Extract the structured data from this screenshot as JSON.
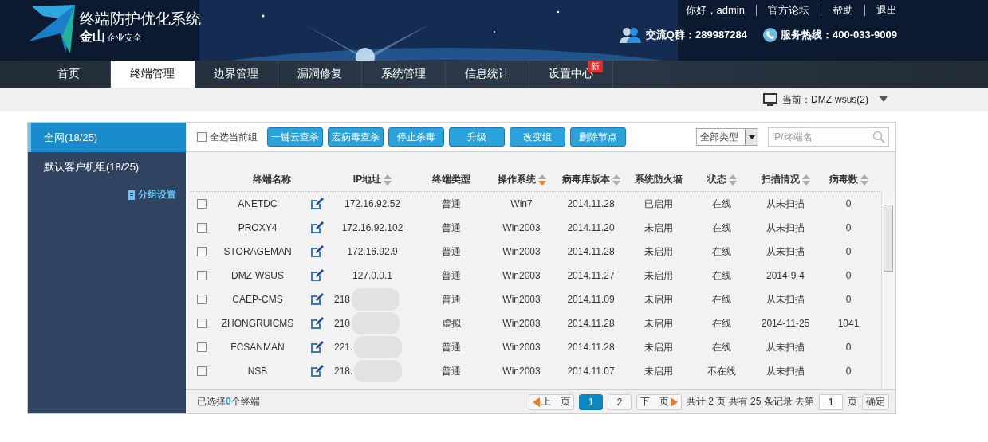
{
  "header": {
    "title": "终端防护优化系统",
    "brand": "金山",
    "brand_sub": "企业安全",
    "links": [
      "你好，admin",
      "官方论坛",
      "帮助",
      "退出"
    ],
    "contacts": [
      {
        "kind": "qq",
        "text": "交流Q群：289987284"
      },
      {
        "kind": "phone",
        "text": "服务热线：400-033-9009"
      }
    ]
  },
  "nav": [
    {
      "label": "首页",
      "selected": false
    },
    {
      "label": "终端管理",
      "selected": true
    },
    {
      "label": "边界管理",
      "selected": false
    },
    {
      "label": "漏洞修复",
      "selected": false
    },
    {
      "label": "系统管理",
      "selected": false
    },
    {
      "label": "信息统计",
      "selected": false
    },
    {
      "label": "设置中心",
      "selected": false,
      "badge": "新"
    }
  ],
  "current": "当前：DMZ-wsus(2)",
  "sidebar": {
    "groups": [
      {
        "label": "全网(18/25)",
        "selected": true
      },
      {
        "label": "默认客户机组(18/25)",
        "selected": false
      }
    ],
    "settings_link": "分组设置"
  },
  "toolbar": {
    "select_all": {
      "label": "全选当前组",
      "checked": false
    },
    "buttons": [
      "一键云查杀",
      "宏病毒查杀",
      "停止杀毒",
      "升级",
      "改变组",
      "删除节点"
    ],
    "type_filter": "全部类型",
    "search": {
      "placeholder": "IP/终端名"
    }
  },
  "table": {
    "columns": [
      {
        "label": "终端名称",
        "sortable": false,
        "sorted": false
      },
      {
        "label": "IP地址",
        "sortable": true,
        "sorted": false
      },
      {
        "label": "终端类型",
        "sortable": false,
        "sorted": false
      },
      {
        "label": "操作系统",
        "sortable": true,
        "sorted": true
      },
      {
        "label": "病毒库版本",
        "sortable": true,
        "sorted": false
      },
      {
        "label": "系统防火墙",
        "sortable": false,
        "sorted": false
      },
      {
        "label": "状态",
        "sortable": true,
        "sorted": false
      },
      {
        "label": "扫描情况",
        "sortable": true,
        "sorted": false
      },
      {
        "label": "病毒数",
        "sortable": true,
        "sorted": false
      }
    ],
    "rows": [
      {
        "checked": false,
        "name": "ANETDC",
        "ip": "172.16.92.52",
        "redacted": false,
        "type": "普通",
        "os": "Win7",
        "db": "2014.11.28",
        "firewall": "已启用",
        "status": "在线",
        "scan": "从未扫描",
        "viruses": "0"
      },
      {
        "checked": false,
        "name": "PROXY4",
        "ip": "172.16.92.102",
        "redacted": false,
        "type": "普通",
        "os": "Win2003",
        "db": "2014.11.20",
        "firewall": "未启用",
        "status": "在线",
        "scan": "从未扫描",
        "viruses": "0"
      },
      {
        "checked": false,
        "name": "STORAGEMAN",
        "ip": "172.16.92.9",
        "redacted": false,
        "type": "普通",
        "os": "Win2003",
        "db": "2014.11.28",
        "firewall": "未启用",
        "status": "在线",
        "scan": "从未扫描",
        "viruses": "0"
      },
      {
        "checked": false,
        "name": "DMZ-WSUS",
        "ip": "127.0.0.1",
        "redacted": false,
        "type": "普通",
        "os": "Win2003",
        "db": "2014.11.27",
        "firewall": "未启用",
        "status": "在线",
        "scan": "2014-9-4",
        "viruses": "0"
      },
      {
        "checked": false,
        "name": "CAEP-CMS",
        "ip": "218",
        "redacted": true,
        "type": "普通",
        "os": "Win2003",
        "db": "2014.11.09",
        "firewall": "未启用",
        "status": "在线",
        "scan": "从未扫描",
        "viruses": "0"
      },
      {
        "checked": false,
        "name": "ZHONGRUICMS",
        "ip": "210",
        "redacted": true,
        "type": "虚拟",
        "os": "Win2003",
        "db": "2014.11.28",
        "firewall": "未启用",
        "status": "在线",
        "scan": "2014-11-25",
        "viruses": "1041"
      },
      {
        "checked": false,
        "name": "FCSANMAN",
        "ip": "221.",
        "redacted": true,
        "type": "普通",
        "os": "Win2003",
        "db": "2014.11.28",
        "firewall": "未启用",
        "status": "在线",
        "scan": "从未扫描",
        "viruses": "0"
      },
      {
        "checked": false,
        "name": "NSB",
        "ip": "218.",
        "redacted": true,
        "type": "普通",
        "os": "Win2003",
        "db": "2014.11.07",
        "firewall": "未启用",
        "status": "不在线",
        "scan": "从未扫描",
        "viruses": "0"
      }
    ]
  },
  "footer": {
    "selected_prefix": "已选择",
    "selected_count": "0",
    "selected_suffix": "个终端",
    "prev": "上一页",
    "pages": [
      {
        "label": "1",
        "selected": true
      },
      {
        "label": "2",
        "selected": false
      }
    ],
    "next": "下一页",
    "summary": "共计 2 页 共有 25 条记录 去第",
    "page_input": "1",
    "page_unit": "页",
    "confirm": "确定"
  }
}
